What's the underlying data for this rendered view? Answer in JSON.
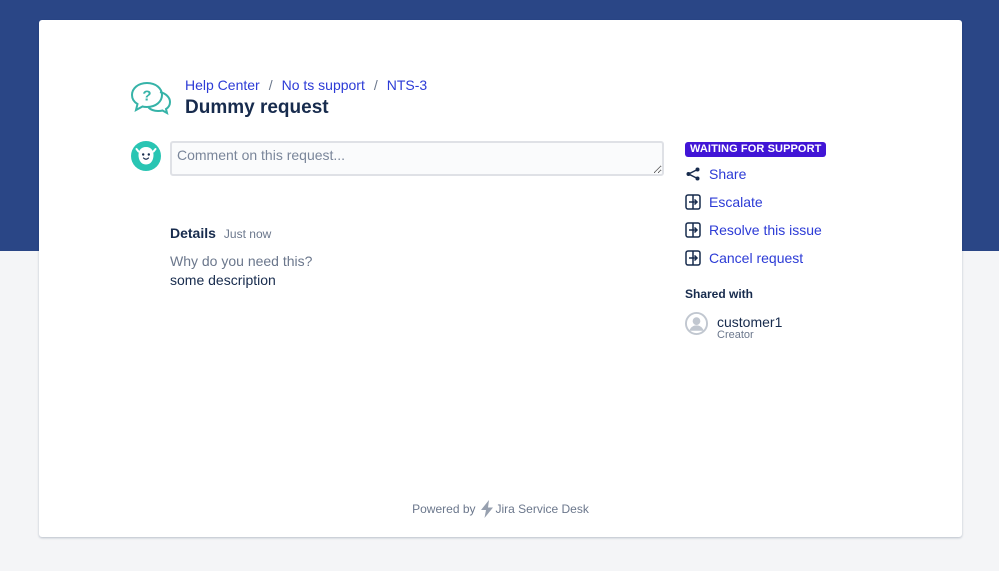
{
  "breadcrumb": {
    "items": [
      "Help Center",
      "No ts support",
      "NTS-3"
    ],
    "separator": "/"
  },
  "request": {
    "title": "Dummy request"
  },
  "comment": {
    "placeholder": "Comment on this request...",
    "value": ""
  },
  "details": {
    "heading": "Details",
    "timestamp": "Just now",
    "field_label": "Why do you need this?",
    "field_value": "some description"
  },
  "sidebar": {
    "status": "WAITING FOR SUPPORT",
    "status_color": "#4115d6",
    "actions": [
      {
        "label": "Share",
        "icon": "share-icon"
      },
      {
        "label": "Escalate",
        "icon": "transition-icon"
      },
      {
        "label": "Resolve this issue",
        "icon": "transition-icon"
      },
      {
        "label": "Cancel request",
        "icon": "transition-icon"
      }
    ],
    "shared_with_title": "Shared with",
    "participants": [
      {
        "name": "customer1",
        "role": "Creator",
        "icon": "user-avatar-icon"
      }
    ]
  },
  "footer": {
    "powered_by": "Powered by",
    "product": "Jira Service Desk",
    "icon": "lightning-bolt-icon"
  },
  "colors": {
    "header_band": "#2a4686",
    "link": "#2c3bd6",
    "accent_teal": "#29c5b3"
  }
}
